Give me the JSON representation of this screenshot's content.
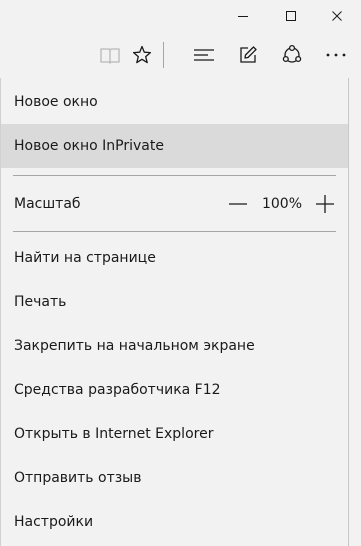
{
  "window": {
    "icons": [
      "minimize-icon",
      "maximize-icon",
      "close-icon"
    ]
  },
  "toolbar": {
    "icons": [
      "reading-view-icon",
      "star-icon",
      "hub-icon",
      "web-note-icon",
      "share-icon",
      "more-icon"
    ]
  },
  "menu": {
    "new_window": "Новое окно",
    "new_inprivate": "Новое окно InPrivate",
    "zoom_label": "Масштаб",
    "zoom_value": "100%",
    "find_on_page": "Найти на странице",
    "print": "Печать",
    "pin_to_start": "Закрепить на начальном экране",
    "dev_tools": "Средства разработчика F12",
    "open_ie": "Открыть в Internet Explorer",
    "send_feedback": "Отправить отзыв",
    "settings": "Настройки"
  },
  "colors": {
    "background": "#f2f2f2",
    "hover": "#dadada",
    "separator": "#a6a6a6"
  }
}
